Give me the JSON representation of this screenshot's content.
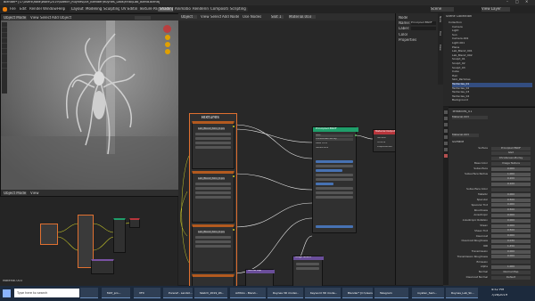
{
  "window": {
    "title": "Blender* [C:\\Users\\Rafa\\Work\\2019\\Sketch_Ruynes\\Art_Blender\\Ruynes_Labs\\Final\\Lab_Blend.blend]",
    "controls": [
      "–",
      "□",
      "✕"
    ]
  },
  "menubar": {
    "items": [
      "File",
      "Edit",
      "Render",
      "Window",
      "Help"
    ],
    "workspaces": [
      "Layout",
      "Modeling",
      "Sculpting",
      "UV Editing",
      "Texture Paint",
      "Shading",
      "Animation",
      "Rendering",
      "Compositing",
      "Scripting"
    ],
    "active_workspace": "Shading",
    "scene": "Scene",
    "view_layer": "View Layer"
  },
  "viewport": {
    "mode": "Object Mode",
    "menus": [
      "View",
      "Select",
      "Add",
      "Object"
    ],
    "shading": "Material Preview"
  },
  "node_editor": {
    "header": [
      "Object",
      "View",
      "Select",
      "Add",
      "Node",
      "Use Nodes",
      "Slot 1",
      "Material.003"
    ],
    "frame_label": "Textures",
    "bsdf_title": "Principled BSDF",
    "output_title": "Material Output",
    "output_sockets": [
      "Surface",
      "Volume",
      "Displacement"
    ],
    "texture_file": "Lab_Blend_Skin_0.png",
    "texture_opts": [
      "Color",
      "Linear",
      "Flat",
      "Repeat",
      "Single Image",
      "Color Space",
      "sRGB",
      "Vector"
    ],
    "bsdf_rows": [
      "GGX",
      "Christensen-Burley",
      "Base Color",
      "Subsurface",
      "Subsurface Radius",
      "Subsurface Color",
      "Metallic",
      "Specular",
      "Specular Tint",
      "Roughness",
      "Anisotropic",
      "Anisotropic Rotation",
      "Sheen",
      "Sheen Tint",
      "Clearcoat",
      "Clearcoat Roughness",
      "IOR",
      "Transmission",
      "Transmission Roughness",
      "Emission",
      "Alpha",
      "Normal",
      "Clearcoat Normal",
      "Tangent"
    ],
    "extra_node_title": "Normal Map",
    "extra_node2_title": "Image Texture"
  },
  "n_panel": {
    "tabs": [
      "Node",
      "Tool",
      "View"
    ],
    "section": "Node",
    "name_label": "Name:",
    "name_value": "Principled BSDF",
    "label_label": "Label:",
    "color": "Color",
    "properties": "Properties"
  },
  "outliner": {
    "header": "Scene Collection",
    "items": [
      "Collection",
      "Camera",
      "Light",
      "Sun",
      "Camera.001",
      "Light.001",
      "Plane",
      "Lab_Blend_001",
      "Lab_Blend_002",
      "Sculpt_01",
      "Sculpt_02",
      "Sculpt_03",
      "Cube",
      "Hair",
      "Skin_Particles",
      "Tentacles_01",
      "Tentacles_02",
      "Tentacles_03",
      "Tentacles_04",
      "Background"
    ],
    "selected": "Tentacles_01"
  },
  "properties": {
    "object": "Tentacles_01",
    "material": "Material.003",
    "section_surface": "Surface",
    "surface": "Principled BSDF",
    "rows": [
      {
        "label": "Surface",
        "value": "Principled BSDF"
      },
      {
        "label": "",
        "value": "GGX"
      },
      {
        "label": "",
        "value": "Christensen-Burley"
      },
      {
        "label": "Base Color",
        "value": "Image Texture"
      },
      {
        "label": "Subsurface",
        "value": "0.000"
      },
      {
        "label": "Subsurface Radius",
        "value": "1.000"
      },
      {
        "label": "",
        "value": "0.200"
      },
      {
        "label": "",
        "value": "0.100"
      },
      {
        "label": "Subsurface Color",
        "value": ""
      },
      {
        "label": "Metallic",
        "value": "0.000"
      },
      {
        "label": "Specular",
        "value": "0.500"
      },
      {
        "label": "Specular Tint",
        "value": "0.000"
      },
      {
        "label": "Roughness",
        "value": "0.500"
      },
      {
        "label": "Anisotropic",
        "value": "0.000"
      },
      {
        "label": "Anisotropic Rotation",
        "value": "0.000"
      },
      {
        "label": "Sheen",
        "value": "0.000"
      },
      {
        "label": "Sheen Tint",
        "value": "0.500"
      },
      {
        "label": "Clearcoat",
        "value": "0.000"
      },
      {
        "label": "Clearcoat Roughness",
        "value": "0.030"
      },
      {
        "label": "IOR",
        "value": "1.450"
      },
      {
        "label": "Transmission",
        "value": "0.000"
      },
      {
        "label": "Transmission Roughness",
        "value": "0.000"
      },
      {
        "label": "Emission",
        "value": ""
      },
      {
        "label": "Alpha",
        "value": "1.000"
      },
      {
        "label": "Normal",
        "value": "Normal Map"
      },
      {
        "label": "Clearcoat Normal",
        "value": "Default"
      }
    ]
  },
  "statusbar": {
    "left": "Material.003"
  },
  "taskbar": {
    "search": "Type here to search",
    "apps": [
      "",
      "MAT_pro...",
      "VFX",
      "Pureref - Landst...",
      "Sketch_2019_Wi...",
      "Artfolio - Blend...",
      "Ruynes 3D model...",
      "Keyword 3D mode...",
      "Blender* [C:\\Users...",
      "Telegram",
      "roystan_Sam...",
      "Ruynes_Lab_Sk..."
    ],
    "time": "4:52 PM",
    "date": "7/26/2019"
  },
  "colors": {
    "accent": "#4772b3",
    "frame_border": "#e07030",
    "bsdf_header": "#1f9e6a",
    "output_header": "#b8353b",
    "texture_header": "#b35a1f",
    "socket_yellow": "#c7c729"
  }
}
